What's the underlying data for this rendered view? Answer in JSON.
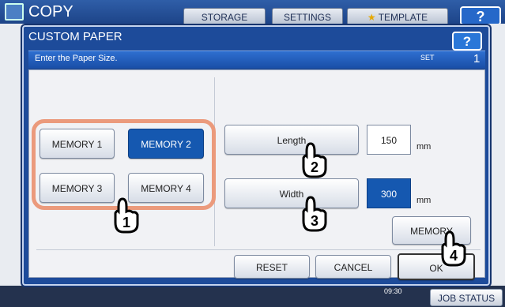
{
  "background": {
    "title": "COPY",
    "tabs": [
      "STORAGE",
      "SETTINGS",
      "TEMPLATE"
    ],
    "help": "?",
    "date_line": "",
    "time": "09:30",
    "job_status": "JOB STATUS"
  },
  "dialog": {
    "title": "CUSTOM PAPER",
    "help": "?",
    "message": "Enter the Paper Size.",
    "set_label": "SET",
    "set_count": "1",
    "memory_buttons": [
      "MEMORY 1",
      "MEMORY 2",
      "MEMORY 3",
      "MEMORY 4"
    ],
    "selected_memory": "MEMORY 2",
    "length_label": "Length",
    "length_value": "150",
    "length_unit": "mm",
    "width_label": "Width",
    "width_value": "300",
    "width_unit": "mm",
    "memory_store_label": "MEMORY",
    "reset": "RESET",
    "cancel": "CANCEL",
    "ok": "OK"
  },
  "annotations": [
    "1",
    "2",
    "3",
    "4"
  ],
  "colors": {
    "accent": "#1558b0",
    "highlight_ring": "#eb9a7c"
  }
}
